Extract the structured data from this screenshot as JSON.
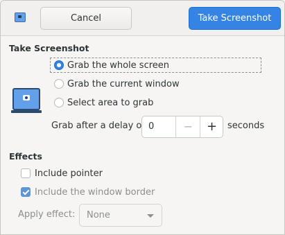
{
  "header": {
    "cancel_label": "Cancel",
    "take_label": "Take Screenshot"
  },
  "take_section": {
    "title": "Take Screenshot",
    "options": [
      {
        "label": "Grab the whole screen",
        "selected": true
      },
      {
        "label": "Grab the current window",
        "selected": false
      },
      {
        "label": "Select area to grab",
        "selected": false
      }
    ],
    "delay_label": "Grab after a delay of",
    "delay_value": "0",
    "minus": "−",
    "plus": "+",
    "seconds_label": "seconds"
  },
  "effects": {
    "title": "Effects",
    "include_pointer": {
      "label": "Include pointer",
      "checked": false
    },
    "include_border": {
      "label": "Include the window border",
      "checked": true,
      "disabled": true
    },
    "apply_label": "Apply effect:",
    "apply_value": "None"
  },
  "colors": {
    "accent": "#3584e4",
    "background": "#f6f5f4",
    "disabled_text": "#8b8e8f"
  }
}
